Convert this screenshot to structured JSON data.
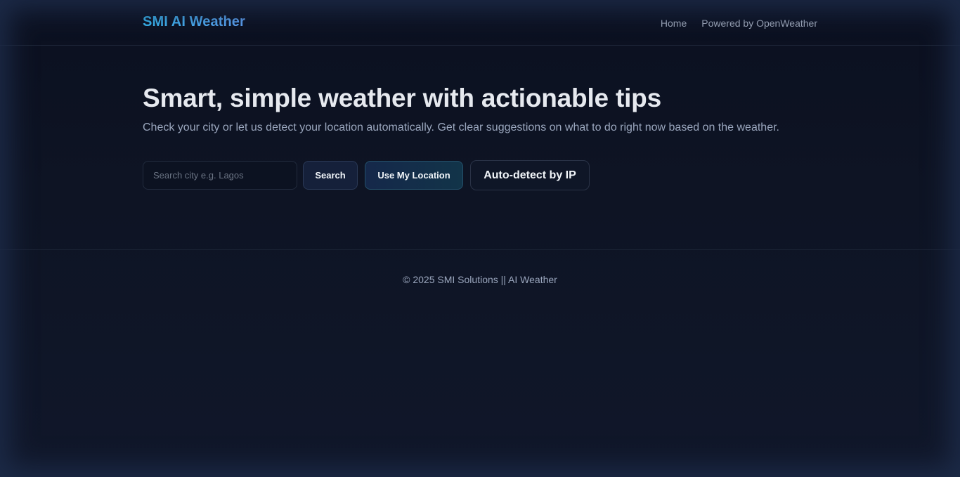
{
  "header": {
    "brand": "SMI AI Weather",
    "nav": [
      {
        "label": "Home"
      },
      {
        "label": "Powered by OpenWeather"
      }
    ]
  },
  "hero": {
    "title": "Smart, simple weather with actionable tips",
    "subtitle": "Check your city or let us detect your location automatically. Get clear suggestions on what to do right now based on the weather."
  },
  "search": {
    "placeholder": "Search city e.g. Lagos",
    "value": "",
    "search_label": "Search",
    "location_label": "Use My Location",
    "auto_label": "Auto-detect by IP"
  },
  "footer": {
    "text": "© 2025 SMI Solutions || AI Weather"
  },
  "colors": {
    "background": "#0f1626",
    "accent": "#38bdf8",
    "text_muted": "#9aa6bd"
  }
}
